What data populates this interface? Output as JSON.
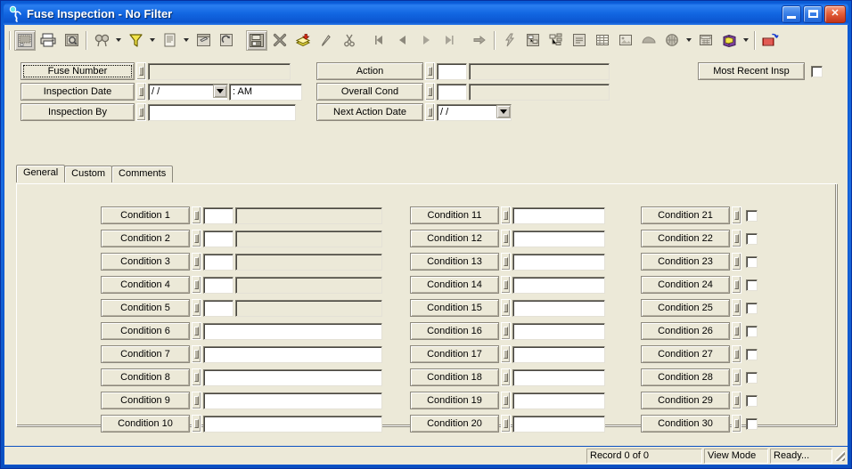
{
  "window": {
    "title": "Fuse Inspection - No Filter",
    "icon": "app-running-figure-icon",
    "minimize_label": "",
    "maximize_label": "",
    "close_label": "✕"
  },
  "toolbar": {
    "groups": [
      {
        "buttons": [
          {
            "name": "new-record-button",
            "icon": "new-record-icon",
            "style": "btnface",
            "dropdown": false
          },
          {
            "name": "print-button",
            "icon": "printer-icon",
            "style": "flat",
            "dropdown": false
          },
          {
            "name": "print-preview-button",
            "icon": "print-preview-icon",
            "style": "flat",
            "dropdown": false
          }
        ]
      },
      {
        "buttons": [
          {
            "name": "find-button",
            "icon": "binoculars-icon",
            "style": "flat",
            "dropdown": true
          },
          {
            "name": "filter-button",
            "icon": "funnel-filter-icon",
            "style": "flat",
            "dropdown": true
          },
          {
            "name": "report-button",
            "icon": "document-icon",
            "style": "flat",
            "dropdown": true
          },
          {
            "name": "form-design-button",
            "icon": "form-pencil-icon",
            "style": "flat",
            "dropdown": false
          },
          {
            "name": "refresh-button",
            "icon": "refresh-arrow-icon",
            "style": "flat",
            "dropdown": false
          }
        ]
      },
      {
        "buttons": [
          {
            "name": "save-button",
            "icon": "floppy-disk-icon",
            "style": "btnface",
            "dropdown": false
          },
          {
            "name": "delete-button",
            "icon": "delete-x-icon",
            "style": "flat",
            "dropdown": false
          },
          {
            "name": "add-record-button",
            "icon": "stack-add-icon",
            "style": "flat",
            "dropdown": false
          },
          {
            "name": "edit-button",
            "icon": "pencil-icon",
            "style": "flat",
            "dropdown": false
          },
          {
            "name": "cut-button",
            "icon": "scissors-icon",
            "style": "flat",
            "dropdown": false
          }
        ]
      },
      {
        "buttons": [
          {
            "name": "first-record-button",
            "icon": "first-record-icon",
            "style": "flat",
            "dropdown": false
          },
          {
            "name": "previous-record-button",
            "icon": "previous-record-icon",
            "style": "flat",
            "dropdown": false
          },
          {
            "name": "next-record-button",
            "icon": "next-record-icon",
            "style": "flat",
            "dropdown": false
          },
          {
            "name": "last-record-button",
            "icon": "last-record-icon",
            "style": "flat",
            "dropdown": false
          }
        ]
      },
      {
        "buttons": [
          {
            "name": "goto-record-button",
            "icon": "right-arrow-icon",
            "style": "flat",
            "dropdown": false
          }
        ]
      },
      {
        "buttons": [
          {
            "name": "lightning-action-button",
            "icon": "lightning-bolt-icon",
            "style": "flat",
            "dropdown": false
          },
          {
            "name": "hierarchy-button",
            "icon": "hierarchy-tree-icon",
            "style": "flat",
            "dropdown": false
          },
          {
            "name": "structure-button",
            "icon": "structure-nodes-icon",
            "style": "flat",
            "dropdown": false
          },
          {
            "name": "notes-button",
            "icon": "notes-lines-icon",
            "style": "flat",
            "dropdown": false
          },
          {
            "name": "grid-view-button",
            "icon": "grid-table-icon",
            "style": "flat",
            "dropdown": false
          },
          {
            "name": "image-button",
            "icon": "picture-icon",
            "style": "flat",
            "dropdown": false
          },
          {
            "name": "map-button",
            "icon": "map-shape-icon",
            "style": "flat",
            "dropdown": false
          },
          {
            "name": "globe-button",
            "icon": "globe-icon",
            "style": "flat",
            "dropdown": true
          },
          {
            "name": "calculator-button",
            "icon": "calculator-icon",
            "style": "flat",
            "dropdown": false
          },
          {
            "name": "help-book-button",
            "icon": "book-icon",
            "style": "flat",
            "dropdown": true
          }
        ]
      },
      {
        "buttons": [
          {
            "name": "exit-button",
            "icon": "exit-door-arrow-icon",
            "style": "flat",
            "dropdown": false
          }
        ]
      }
    ]
  },
  "form_header": {
    "rows": [
      {
        "label": "Fuse Number",
        "name": "fuse-number",
        "focused": true,
        "type": "text",
        "value": "",
        "disabled": true
      },
      {
        "label": "Inspection Date",
        "name": "inspection-date",
        "focused": false,
        "type": "date-time",
        "value": "/  /",
        "time_value": ":    AM"
      },
      {
        "label": "Inspection By",
        "name": "inspection-by",
        "focused": false,
        "type": "text",
        "value": "",
        "disabled": false
      }
    ],
    "rows2": [
      {
        "label": "Action",
        "name": "action",
        "type": "code-desc",
        "code_value": "",
        "desc_value": ""
      },
      {
        "label": "Overall Cond",
        "name": "overall-cond",
        "type": "code-desc",
        "code_value": "",
        "desc_value": ""
      },
      {
        "label": "Next Action Date",
        "name": "next-action-date",
        "type": "date",
        "value": "/  /"
      }
    ],
    "most_recent": {
      "label": "Most Recent Insp",
      "name": "most-recent-insp",
      "checkbox_checked": false
    }
  },
  "tabs": [
    {
      "label": "General",
      "name": "tab-general",
      "active": true
    },
    {
      "label": "Custom",
      "name": "tab-custom",
      "active": false
    },
    {
      "label": "Comments",
      "name": "tab-comments",
      "active": false
    }
  ],
  "conditions": {
    "column1": [
      {
        "label": "Condition 1",
        "type": "code-desc"
      },
      {
        "label": "Condition 2",
        "type": "code-desc"
      },
      {
        "label": "Condition 3",
        "type": "code-desc"
      },
      {
        "label": "Condition 4",
        "type": "code-desc"
      },
      {
        "label": "Condition 5",
        "type": "code-desc"
      },
      {
        "label": "Condition 6",
        "type": "text"
      },
      {
        "label": "Condition 7",
        "type": "text"
      },
      {
        "label": "Condition 8",
        "type": "text"
      },
      {
        "label": "Condition 9",
        "type": "text"
      },
      {
        "label": "Condition 10",
        "type": "text"
      }
    ],
    "column2": [
      {
        "label": "Condition 11",
        "type": "text"
      },
      {
        "label": "Condition 12",
        "type": "text"
      },
      {
        "label": "Condition 13",
        "type": "text"
      },
      {
        "label": "Condition 14",
        "type": "text"
      },
      {
        "label": "Condition 15",
        "type": "text"
      },
      {
        "label": "Condition 16",
        "type": "text"
      },
      {
        "label": "Condition 17",
        "type": "text"
      },
      {
        "label": "Condition 18",
        "type": "text"
      },
      {
        "label": "Condition 19",
        "type": "text"
      },
      {
        "label": "Condition 20",
        "type": "text"
      }
    ],
    "column3": [
      {
        "label": "Condition 21",
        "type": "checkbox",
        "checked": false
      },
      {
        "label": "Condition 22",
        "type": "checkbox",
        "checked": false
      },
      {
        "label": "Condition 23",
        "type": "checkbox",
        "checked": false
      },
      {
        "label": "Condition 24",
        "type": "checkbox",
        "checked": false
      },
      {
        "label": "Condition 25",
        "type": "checkbox",
        "checked": false
      },
      {
        "label": "Condition 26",
        "type": "checkbox",
        "checked": false
      },
      {
        "label": "Condition 27",
        "type": "checkbox",
        "checked": false
      },
      {
        "label": "Condition 28",
        "type": "checkbox",
        "checked": false
      },
      {
        "label": "Condition 29",
        "type": "checkbox",
        "checked": false
      },
      {
        "label": "Condition 30",
        "type": "checkbox",
        "checked": false
      }
    ]
  },
  "statusbar": {
    "record_count": "Record 0 of 0",
    "mode": "View Mode",
    "state": "Ready...",
    "resize_grip": "resize-grip-icon"
  },
  "colors": {
    "titlebar_accent": "#0a5bd3",
    "window_face": "#ece9d8",
    "button_face": "#d4d0c8",
    "border_dark": "#8c887c",
    "close_button": "#c2341a",
    "field_white": "#ffffff"
  }
}
